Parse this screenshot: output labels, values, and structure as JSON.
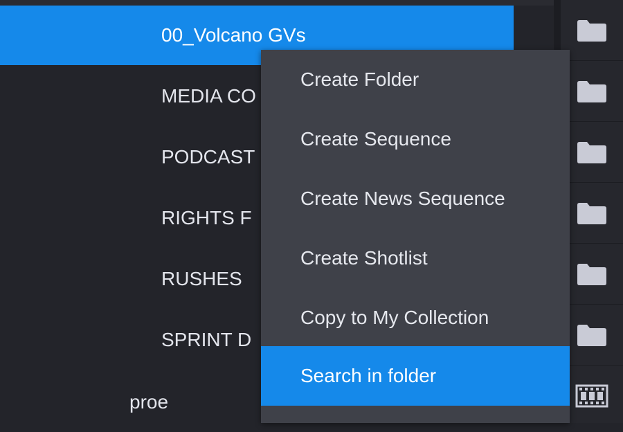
{
  "tree": {
    "rows": [
      {
        "label": "00_Volcano GVs",
        "selected": true
      },
      {
        "label": "MEDIA CO"
      },
      {
        "label": "PODCAST"
      },
      {
        "label": "RIGHTS F"
      },
      {
        "label": "RUSHES"
      },
      {
        "label": "SPRINT D"
      },
      {
        "label": "proe"
      }
    ]
  },
  "icons": [
    "folder-icon",
    "folder-icon",
    "folder-icon",
    "folder-icon",
    "folder-icon",
    "folder-icon",
    "filmstrip-icon"
  ],
  "context_menu": {
    "items": [
      {
        "label": "Create Folder"
      },
      {
        "label": "Create Sequence"
      },
      {
        "label": "Create News Sequence"
      },
      {
        "label": "Create Shotlist"
      },
      {
        "label": "Copy to My Collection"
      },
      {
        "label": "Search in folder",
        "active": true
      }
    ]
  },
  "colors": {
    "accent": "#1589ea",
    "background": "#23242a",
    "menu_background": "#3f4149",
    "icon_color": "#c9cbd6"
  }
}
